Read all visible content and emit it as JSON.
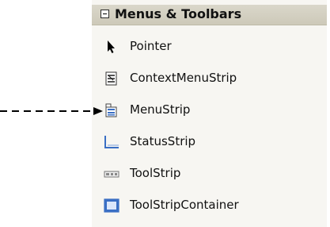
{
  "toolbox": {
    "section_title": "Menus & Toolbars",
    "items": [
      {
        "label": "Pointer",
        "icon": "pointer-icon"
      },
      {
        "label": "ContextMenuStrip",
        "icon": "context-menu-strip-icon"
      },
      {
        "label": "MenuStrip",
        "icon": "menu-strip-icon"
      },
      {
        "label": "StatusStrip",
        "icon": "status-strip-icon"
      },
      {
        "label": "ToolStrip",
        "icon": "tool-strip-icon"
      },
      {
        "label": "ToolStripContainer",
        "icon": "tool-strip-container-icon"
      }
    ]
  },
  "annotation": {
    "arrow_target": "MenuStrip"
  },
  "colors": {
    "panel_background": "#f7f6f2",
    "header_background": "#d3d0c1",
    "icon_blue": "#3a6fc4"
  }
}
